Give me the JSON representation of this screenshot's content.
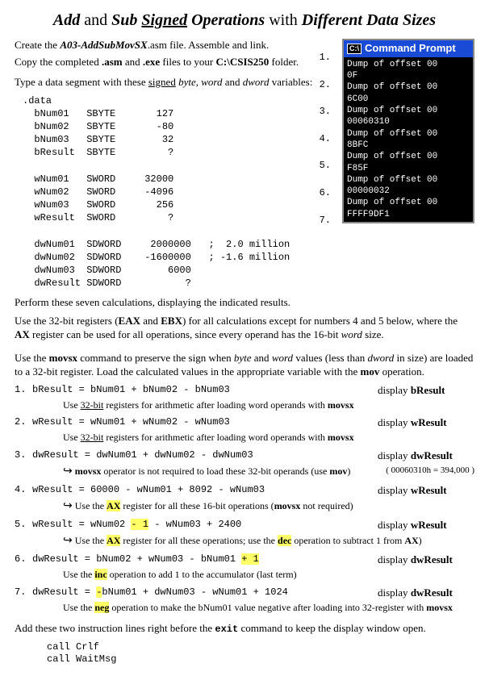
{
  "title": {
    "w1": "Add",
    "w2": "and",
    "w3": "Sub",
    "w4": "Signed",
    "w5": "Operations",
    "w6": "with",
    "w7": "Different Data Sizes"
  },
  "intro1a": "Create the ",
  "intro1b": "A03-AddSubMovSX",
  "intro1c": ".asm file.  Assemble and link.",
  "intro2a": "Copy the completed ",
  "intro2b": ".asm",
  "intro2c": " and ",
  "intro2d": ".exe",
  "intro2e": " files to your ",
  "intro2f": "C:\\CSIS250",
  "intro2g": " folder.",
  "intro3a": "Type a data segment with these ",
  "intro3b": "signed",
  "intro3c": " byte",
  "intro3d": ", ",
  "intro3e": "word",
  "intro3f": " and ",
  "intro3g": "dword",
  "intro3h": " variables:",
  "prompt_title": "Command Prompt",
  "prompt_lines": {
    "l0": "Dump of offset 00",
    "l1": "0F",
    "l2": "Dump of offset 00",
    "l3": "6C00",
    "l4": "Dump of offset 00",
    "l5": "00060310",
    "l6": "Dump of offset 00",
    "l7": "8BFC",
    "l8": "Dump of offset 00",
    "l9": "F85F",
    "l10": "Dump of offset 00",
    "l11": "00000032",
    "l12": "Dump of offset 00",
    "l13": "FFFF9DF1"
  },
  "nums": {
    "n1": "1.",
    "n2": "2.",
    "n3": "3.",
    "n4": "4.",
    "n5": "5.",
    "n6": "6.",
    "n7": "7."
  },
  "dataseg": ".data\n  bNum01   SBYTE       127\n  bNum02   SBYTE       -80\n  bNum03   SBYTE        32\n  bResult  SBYTE         ?\n\n  wNum01   SWORD     32000\n  wNum02   SWORD     -4096\n  wNum03   SWORD       256\n  wResult  SWORD         ?\n\n  dwNum01  SDWORD     2000000   ;  2.0 million\n  dwNum02  SDWORD    -1600000   ; -1.6 million\n  dwNum03  SDWORD        6000\n  dwResult SDWORD           ?",
  "para1": "Perform these seven calculations, displaying the indicated results.",
  "para2a": "Use the 32-bit registers (",
  "para2b": "EAX",
  "para2c": " and ",
  "para2d": "EBX",
  "para2e": ") for all calculations except for numbers 4 and 5 below, where the ",
  "para2f": "AX",
  "para2g": " register can be used for all operations, since every operand has the 16-bit ",
  "para2h": "word",
  "para2i": " size.",
  "para3a": "Use the ",
  "para3b": "movsx",
  "para3c": " command to preserve the sign when ",
  "para3d": "byte",
  "para3e": " and ",
  "para3f": "word",
  "para3g": " values (less than ",
  "para3h": "dword",
  "para3i": " in size) are loaded to a 32-bit register. Load the calculated values in the appropriate variable with the ",
  "para3j": "mov",
  "para3k": " operation.",
  "calc": {
    "c1": {
      "n": "1.",
      "expr": "bResult  =  bNum01  +  bNum02  -  bNum03",
      "disp": "bResult"
    },
    "c2": {
      "n": "2.",
      "expr": "wResult  =  wNum01  +  wNum02  -  wNum03",
      "disp": "wResult"
    },
    "c3": {
      "n": "3.",
      "expr": "dwResult =  dwNum01 +  dwNum02  -  dwNum03",
      "disp": "dwResult"
    },
    "c4": {
      "n": "4.",
      "expr_a": "wResult  =  60000  -  wNum01  +  8092  -  wNum03",
      "disp": "wResult"
    },
    "c5": {
      "n": "5.",
      "expr_a": "wResult  =  wNum02 ",
      "expr_hl1": "-  1",
      "expr_b": "  -   wNum03  +  2400",
      "disp": "wResult"
    },
    "c6": {
      "n": "6.",
      "expr_a": "dwResult =  bNum02  +  wNum03  -  bNum01  ",
      "expr_hl1": "+  1",
      "disp": "dwResult"
    },
    "c7": {
      "n": "7.",
      "expr_a": "dwResult =  ",
      "expr_hl1": "-",
      "expr_b": "bNum01  +  dwNum03  -  wNum01  +  1024",
      "disp": "dwResult"
    }
  },
  "note1a": "Use ",
  "note1b": "32-bit",
  "note1c": " registers for arithmetic after loading word operands with ",
  "note1d": "movsx",
  "note2a": "Use ",
  "note2b": "32-bit",
  "note2c": " registers for arithmetic after loading word operands with ",
  "note2d": "movsx",
  "note3a": "movsx",
  "note3b": "  operator is not required to load these 32-bit operands  (use ",
  "note3c": "mov",
  "note3d": ")",
  "note3side": "( 00060310h = 394,000 )",
  "note4a": "Use the ",
  "note4b": "AX",
  "note4c": " register for all these 16-bit operations (",
  "note4d": "movsx",
  "note4e": " not required)",
  "note5a": "Use the ",
  "note5b": "AX",
  "note5c": " register for all these operations; use the ",
  "note5d": "dec",
  "note5e": " operation to subtract 1 from ",
  "note5f": "AX",
  "note5g": ")",
  "note6a": "Use the  ",
  "note6b": "inc",
  "note6c": " operation to add 1 to the accumulator (last term)",
  "note7a": "Use the  ",
  "note7b": "neg",
  "note7c": " operation to make the bNum01 value negative after loading into 32-register with  ",
  "note7d": "movsx",
  "footer_a": "Add these two instruction lines right before the ",
  "footer_b": "exit",
  "footer_c": " command to keep the display window open.",
  "footer_code": "call Crlf\ncall WaitMsg",
  "display_label": "display  "
}
